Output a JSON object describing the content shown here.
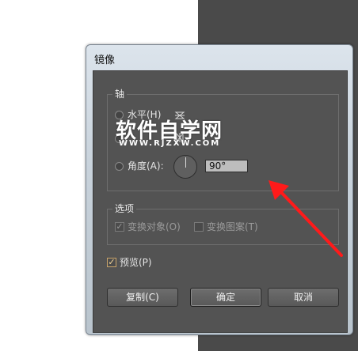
{
  "dialog": {
    "title": "镜像",
    "axis": {
      "legend": "轴",
      "horizontal_label": "水平(H)",
      "angle_label": "角度(A):",
      "angle_value": "90°"
    },
    "options": {
      "legend": "选项",
      "transform_objects": "变换对象(O)",
      "transform_patterns": "变换图案(T)"
    },
    "preview_label": "预览(P)",
    "buttons": {
      "copy": "复制(C)",
      "ok": "确定",
      "cancel": "取消"
    }
  },
  "watermark": {
    "text": "软件自学网",
    "url": "WWW.RJZXW.COM"
  },
  "colors": {
    "annotation_arrow": "#ff1a1a"
  }
}
